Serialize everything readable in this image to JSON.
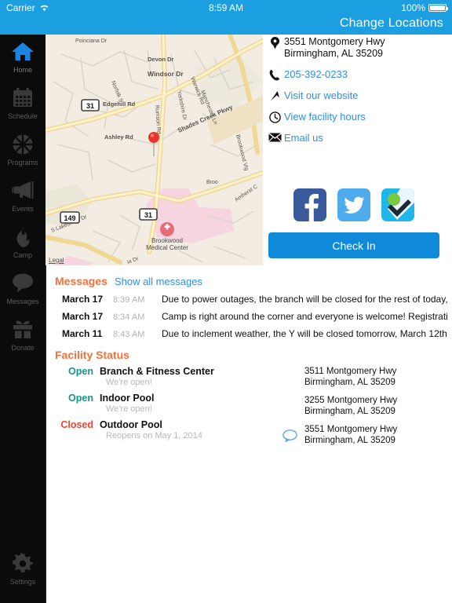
{
  "status_bar": {
    "carrier": "Carrier",
    "wifi_icon": "wifi-icon",
    "time": "8:59 AM",
    "battery_percent": "100%",
    "battery_icon": "battery-icon"
  },
  "navbar": {
    "change_locations": "Change Locations",
    "background": "#1b9fe0"
  },
  "sidebar": {
    "background": "#0b0b0b",
    "active_color": "#1b84e0",
    "items": [
      {
        "label": "Home",
        "icon": "home-icon",
        "active": true
      },
      {
        "label": "Schedule",
        "icon": "calendar-icon",
        "active": false
      },
      {
        "label": "Programs",
        "icon": "basketball-icon",
        "active": false
      },
      {
        "label": "Events",
        "icon": "megaphone-icon",
        "active": false
      },
      {
        "label": "Camp",
        "icon": "flame-icon",
        "active": false
      },
      {
        "label": "Messages",
        "icon": "speech-bubble-icon",
        "active": false
      },
      {
        "label": "Donate",
        "icon": "gift-icon",
        "active": false
      }
    ],
    "settings": {
      "label": "Settings",
      "icon": "gear-icon"
    }
  },
  "map": {
    "marker": "red-map-pin",
    "legal_label": "Legal",
    "poi": "Brookwood Medical Center",
    "route_shields": [
      "31",
      "149",
      "31"
    ],
    "street_labels": [
      "Poinciana Dr",
      "Devon Dr",
      "Windsor Dr",
      "Norfolk S",
      "Warwick Rd",
      "Manchester Ln",
      "Edgehill Rd",
      "Rumson Rd",
      "Yorkshire Dr",
      "Shades Creek Pkwy",
      "Ashley Rd",
      "Brookwood Vlg",
      "S Lakeshore Dr",
      "Amherst C"
    ]
  },
  "contact": {
    "address": {
      "icon": "map-pin-icon",
      "line1": "3551 Montgomery Hwy",
      "line2": "Birmingham, AL 35209"
    },
    "phone": {
      "icon": "phone-icon",
      "label": "205-392-0233"
    },
    "website": {
      "icon": "arrow-up-right-icon",
      "label": "Visit our website"
    },
    "hours": {
      "icon": "clock-icon",
      "label": "View facility hours"
    },
    "email": {
      "icon": "envelope-icon",
      "label": "Email us"
    }
  },
  "social": [
    {
      "name": "facebook-icon",
      "color": "#3b5a9b"
    },
    {
      "name": "twitter-icon",
      "color": "#4eabee"
    },
    {
      "name": "foursquare-icon",
      "color": "#1fb6e8"
    }
  ],
  "check_in": {
    "label": "Check In",
    "color": "#0f8ad8"
  },
  "messages": {
    "title": "Messages",
    "show_all_label": "Show all messages",
    "title_color": "#f4713b",
    "rows": [
      {
        "date": "March 17",
        "time": "8:39 AM",
        "text": "Due to power outages, the branch will be closed for the rest of today,"
      },
      {
        "date": "March 17",
        "time": "8:34 AM",
        "text": "Camp is right around the corner and everyone is welcome! Registration beg"
      },
      {
        "date": "March 11",
        "time": "8:43 AM",
        "text": "Due to inclement weather, the Y will be closed tomorrow, March 12th."
      }
    ]
  },
  "facility_status": {
    "title": "Facility Status",
    "title_color": "#f4713b",
    "rows": [
      {
        "status": "Open",
        "name": "Branch & Fitness Center",
        "note": "We're open!",
        "status_color": "#17958c"
      },
      {
        "status": "Open",
        "name": "Indoor Pool",
        "note": "We're open!",
        "status_color": "#17958c"
      },
      {
        "status": "Closed",
        "name": "Outdoor Pool",
        "note": "Reopens on May 1, 2014",
        "status_color": "#f2402e"
      }
    ],
    "addresses": [
      {
        "line1": "3511 Montgomery Hwy",
        "line2": "Birmingham, AL 35209",
        "icon": ""
      },
      {
        "line1": "3255 Montgomery Hwy",
        "line2": "Birmingham, AL 35209",
        "icon": ""
      },
      {
        "line1": "3551 Montgomery Hwy",
        "line2": "Birmingham, AL 35209",
        "icon": "speech-bubble-icon"
      }
    ]
  }
}
